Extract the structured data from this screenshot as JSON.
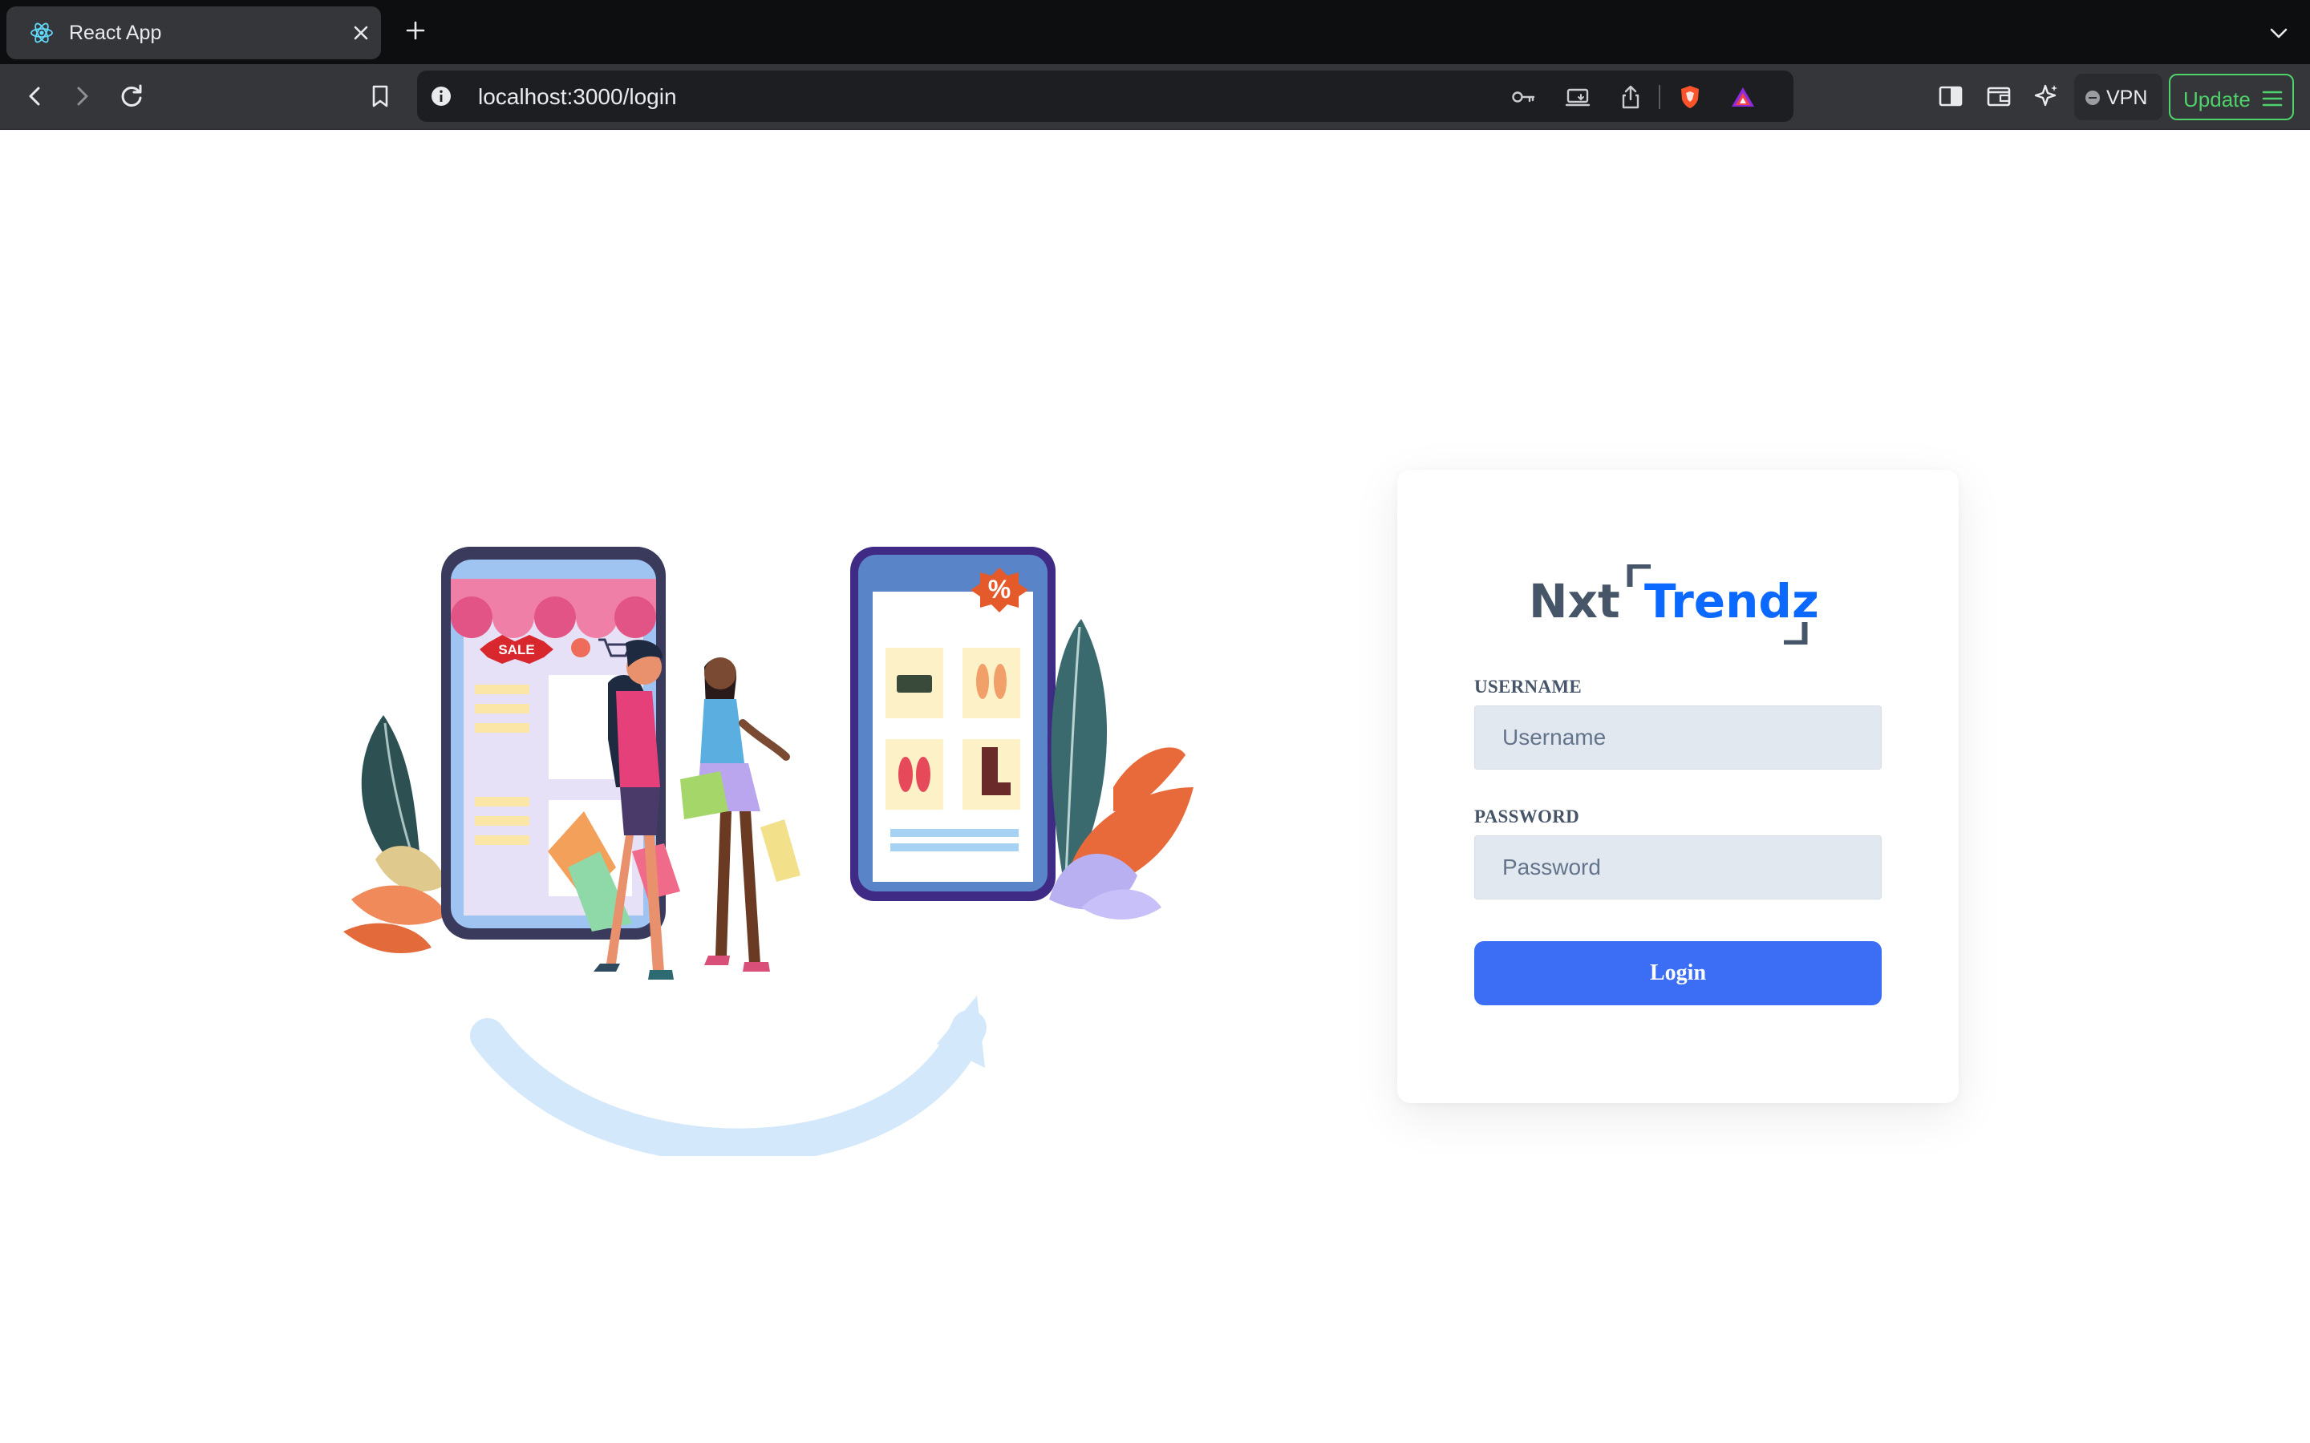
{
  "browser": {
    "tab": {
      "title": "React App",
      "icon": "react-icon"
    },
    "address_bar": {
      "url": "localhost:3000/login"
    },
    "vpn_label": "VPN",
    "update_label": "Update"
  },
  "login": {
    "logo": {
      "part1": "Nxt",
      "part2": "Trendz"
    },
    "username": {
      "label": "USERNAME",
      "placeholder": "Username",
      "value": ""
    },
    "password": {
      "label": "PASSWORD",
      "placeholder": "Password",
      "value": ""
    },
    "button_label": "Login"
  },
  "illustration": {
    "sale_badge": "SALE",
    "discount_badge": "%"
  },
  "colors": {
    "accent": "#3b6ef5",
    "brand_blue": "#0b69ff",
    "label_slate": "#475569",
    "input_bg": "#e2e8f0",
    "update_green": "#4fd26a"
  }
}
